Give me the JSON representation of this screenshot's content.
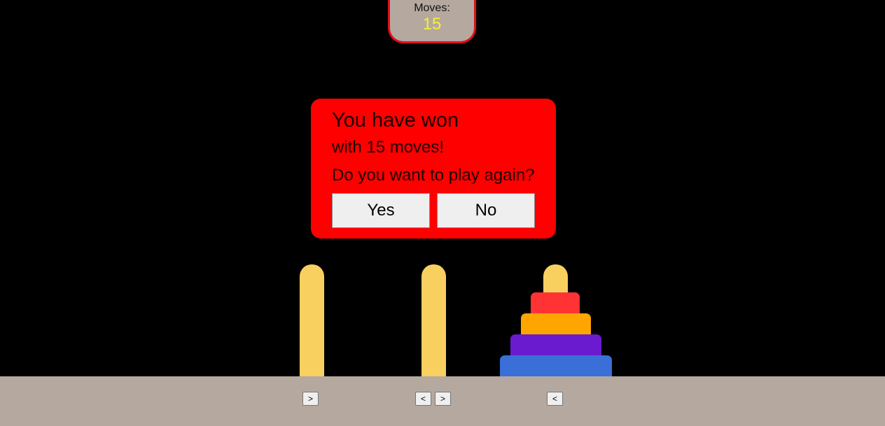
{
  "moves": {
    "label": "Moves:",
    "value": "15",
    "value_color": "#f4ef3a",
    "box_border_color": "#e0101a"
  },
  "dialog": {
    "title": "You have won",
    "subtitle": "with 15 moves!",
    "question": "Do you want to play again?",
    "yes_label": "Yes",
    "no_label": "No",
    "background_color": "#ff0000"
  },
  "pegs": [
    {
      "name": "peg-1",
      "disks": [],
      "controls": [
        ">"
      ]
    },
    {
      "name": "peg-2",
      "disks": [],
      "controls": [
        "<",
        ">"
      ]
    },
    {
      "name": "peg-3",
      "disks": [
        "red",
        "orange",
        "purple",
        "blue"
      ],
      "controls": [
        "<"
      ]
    }
  ],
  "colors": {
    "peg": "#f8d060",
    "floor": "#b5a89f",
    "disk_red": "#ff3333",
    "disk_orange": "#ffa500",
    "disk_purple": "#6a1bd0",
    "disk_blue": "#3a6fd8"
  }
}
